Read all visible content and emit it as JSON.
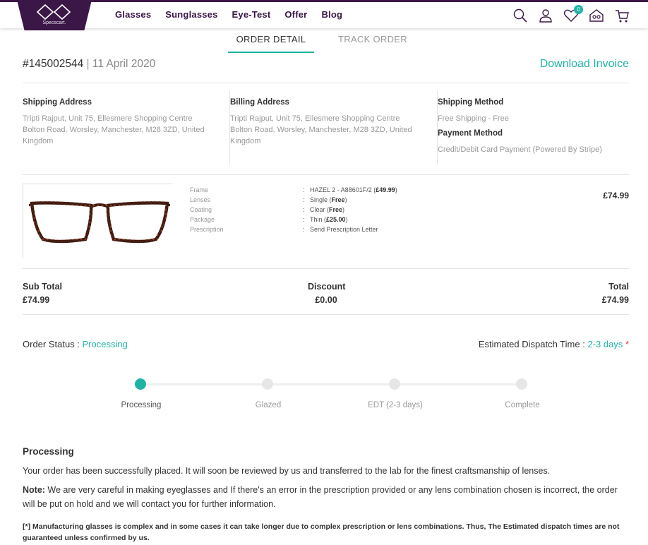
{
  "header": {
    "logo_text": "Specscart.",
    "nav": [
      "Glasses",
      "Sunglasses",
      "Eye-Test",
      "Offer",
      "Blog"
    ],
    "wishlist_count": "0"
  },
  "tabs": {
    "order_detail": "ORDER DETAIL",
    "track_order": "TRACK ORDER"
  },
  "order": {
    "number": "#145002544",
    "separator": "|",
    "date": "11 April 2020",
    "download_invoice": "Download Invoice"
  },
  "shipping_address": {
    "title": "Shipping Address",
    "text": "Tripti Rajput, Unit 75, Ellesmere Shopping Centre Bolton Road, Worsley, Manchester, M28 3ZD, United Kingdom"
  },
  "billing_address": {
    "title": "Billing Address",
    "text": "Tripti Rajput, Unit 75, Ellesmere Shopping Centre Bolton Road, Worsley, Manchester, M28 3ZD, United Kingdom"
  },
  "shipping_method": {
    "title": "Shipping Method",
    "text": "Free Shipping - Free"
  },
  "payment_method": {
    "title": "Payment Method",
    "text": "Credit/Debit Card Payment (Powered By Stripe)"
  },
  "product": {
    "price": "£74.99",
    "specs": [
      {
        "key": "Frame",
        "value": "HAZEL 2 - A88601F/2",
        "extra": "£49.99"
      },
      {
        "key": "Lenses",
        "value": "Single",
        "extra": "Free"
      },
      {
        "key": "Coating",
        "value": "Clear",
        "extra": "Free"
      },
      {
        "key": "Package",
        "value": "Thin",
        "extra": "£25.00"
      },
      {
        "key": "Prescription",
        "value": "Send Prescription Letter",
        "extra": ""
      }
    ]
  },
  "totals": {
    "subtotal_label": "Sub Total",
    "subtotal": "£74.99",
    "discount_label": "Discount",
    "discount": "£0.00",
    "total_label": "Total",
    "total": "£74.99"
  },
  "status": {
    "label": "Order Status :",
    "value": "Processing",
    "dispatch_label": "Estimated Dispatch Time :",
    "dispatch_value": "2-3 days",
    "dispatch_star": "*"
  },
  "progress": {
    "steps": [
      "Processing",
      "Glazed",
      "EDT (2-3 days)",
      "Complete"
    ],
    "current_step": 1
  },
  "description": {
    "title": "Processing",
    "para1": "Your order has been successfully placed. It will soon be reviewed by us and transferred to the lab for the finest craftsmanship of lenses.",
    "note_label": "Note:",
    "note": " We are very careful in making eyeglasses and If there's an error in the prescription provided or any lens combination chosen is incorrect, the order will be put on hold and we will contact you for further information.",
    "footnote": "[*] Manufacturing glasses is complex and in some cases it can take longer due to complex prescription or lens combinations. Thus, The Estimated dispatch times are not guaranteed unless confirmed by us."
  },
  "colors": {
    "brand": "#3a1746",
    "accent": "#1fb3a5"
  }
}
